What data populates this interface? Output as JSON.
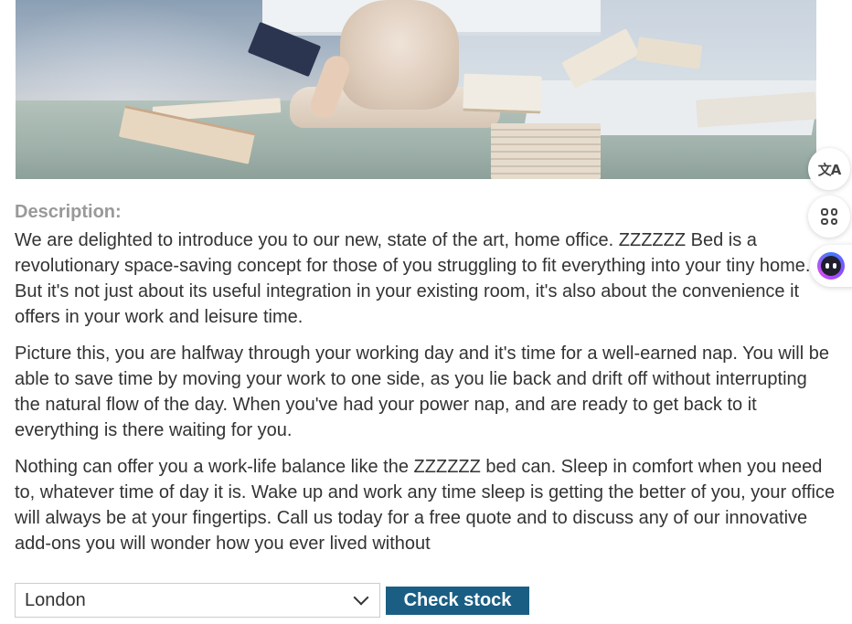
{
  "product": {
    "image_alt": "Product image"
  },
  "description": {
    "label": "Description:",
    "paragraphs": [
      {
        "lines": [
          "We are delighted to introduce you to our new, state of the art, home office. ZZZZZZ Bed is a",
          "revolutionary space-saving concept for those of you struggling to fit everything into your tiny home.",
          "But it's not just about its useful integration in your existing room, it's also about the convenience it",
          "offers in your work and leisure time."
        ]
      },
      {
        "lines": [
          "Picture this, you are halfway through your working day and it's time for a well-earned nap. You will be",
          "able to save time by moving your work to one side, as you lie back and drift off without interrupting",
          "the natural flow of the day. When you've had your power nap, and are ready to get back to it",
          "everything is there waiting for you."
        ]
      },
      {
        "lines": [
          "Nothing can offer you a work-life balance like the ZZZZZZ bed can. Sleep in comfort when you need",
          "to, whatever time of day it is. Wake up and work any time sleep is getting the better of you, your office",
          "will always be at your fingertips. Call us today for a free quote and to discuss any of our innovative",
          "add-ons you will wonder how you ever lived without"
        ]
      }
    ]
  },
  "stock_form": {
    "selected_store": "London",
    "button_label": "Check stock",
    "button_color": "#1a5e84"
  },
  "side_toolbar": {
    "items": [
      {
        "icon": "translate-icon"
      },
      {
        "icon": "apps-grid-icon"
      },
      {
        "icon": "assistant-bot-icon"
      }
    ]
  },
  "colors": {
    "label_gray": "#999999",
    "text": "#333333"
  }
}
